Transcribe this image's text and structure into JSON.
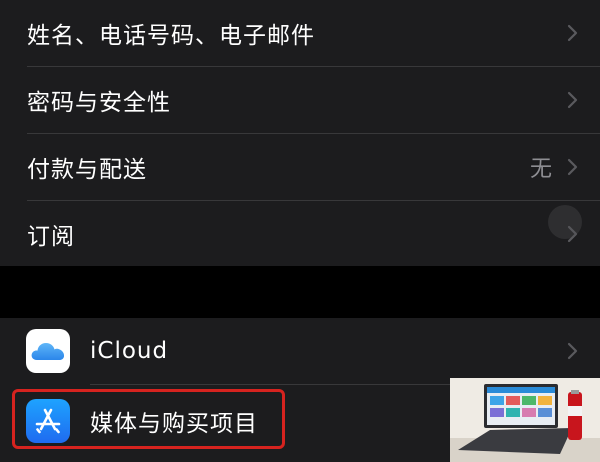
{
  "account_group": {
    "items": [
      {
        "label": "姓名、电话号码、电子邮件",
        "value": ""
      },
      {
        "label": "密码与安全性",
        "value": ""
      },
      {
        "label": "付款与配送",
        "value": "无"
      },
      {
        "label": "订阅",
        "value": ""
      }
    ]
  },
  "services_group": {
    "items": [
      {
        "label": "iCloud",
        "icon": "icloud-icon"
      },
      {
        "label": "媒体与购买项目",
        "icon": "app-store-icon"
      }
    ]
  },
  "colors": {
    "background": "#000000",
    "row_background": "#1c1c1e",
    "separator": "#38383a",
    "secondary_text": "#8e8e93",
    "highlight": "#d6231f",
    "icloud_blue": "#3d9df3",
    "app_store_blue": "#1c8cf9"
  }
}
